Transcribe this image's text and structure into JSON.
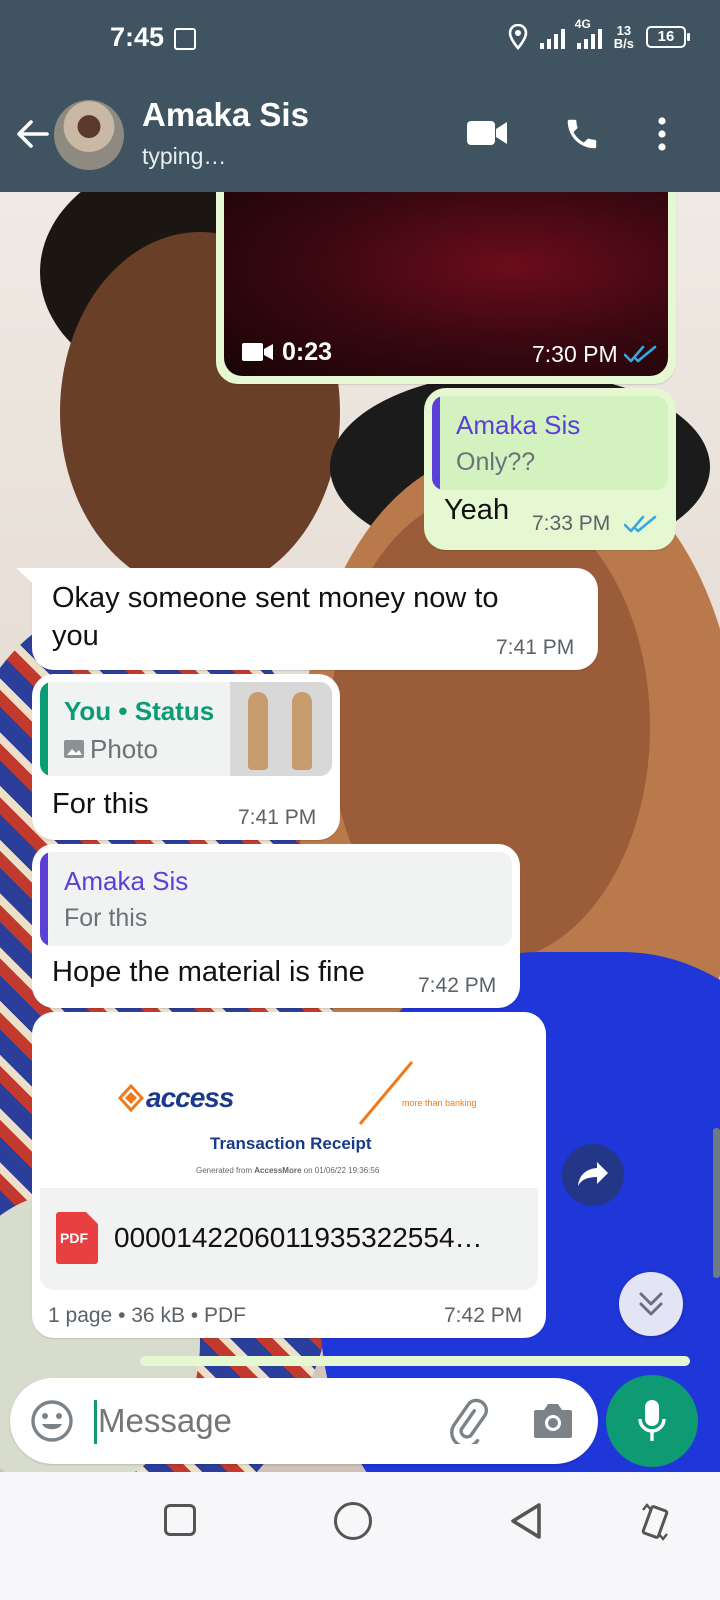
{
  "status_bar": {
    "time": "7:45",
    "network_type": "4G",
    "net_speed_value": "13",
    "net_speed_unit": "B/s",
    "battery": "16"
  },
  "header": {
    "contact_name": "Amaka Sis",
    "contact_status": "typing…"
  },
  "messages": {
    "video": {
      "duration": "0:23",
      "time": "7:30 PM"
    },
    "reply_yeah": {
      "quote_author": "Amaka Sis",
      "quote_text": "Only??",
      "text": "Yeah",
      "time": "7:33 PM"
    },
    "okay": {
      "text_line1": "Okay someone sent money now to",
      "text_line2": "you",
      "time": "7:41 PM"
    },
    "status_reply": {
      "quote_author": "You • Status",
      "quote_type": "Photo",
      "text": "For this",
      "time": "7:41 PM"
    },
    "material": {
      "quote_author": "Amaka Sis",
      "quote_text": "For this",
      "text": "Hope the material is fine",
      "time": "7:42 PM"
    },
    "document": {
      "brand": "access",
      "tagline": "more than banking",
      "receipt_title": "Transaction Receipt",
      "receipt_sub_prefix": "Generated from",
      "receipt_sub_app": "AccessMore",
      "receipt_sub_suffix": "on 01/06/22 19:36:56",
      "file_badge": "PDF",
      "file_name": "00001422060119353225​54…",
      "meta": "1 page • 36 kB • PDF",
      "time": "7:42 PM"
    }
  },
  "input": {
    "placeholder": "Message"
  },
  "colors": {
    "header_bg": "#3f5460",
    "outgoing_bubble": "#e6f8d2",
    "incoming_bubble": "#ffffff",
    "quote_purple": "#5b3fd6",
    "quote_green": "#0a9c73",
    "tick_blue": "#35a7e6",
    "mic_green": "#0e9a73"
  }
}
